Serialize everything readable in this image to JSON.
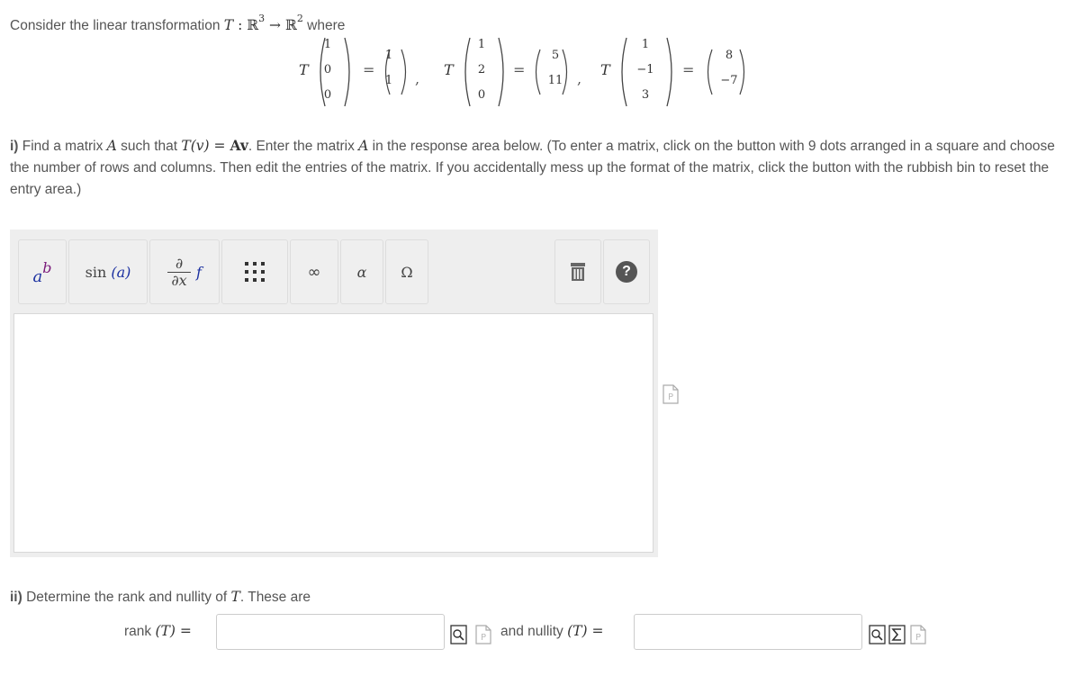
{
  "intro": {
    "prefix": "Consider the linear transformation ",
    "map_T": "T",
    "colon": " : ",
    "domain": "ℝ",
    "domain_exp": "3",
    "arrow": " → ",
    "codomain": "ℝ",
    "codomain_exp": "2",
    "suffix": " where"
  },
  "equations": [
    {
      "T": "T",
      "input": [
        "1",
        "0",
        "0"
      ],
      "output": [
        "1",
        "1"
      ]
    },
    {
      "T": "T",
      "input": [
        "1",
        "2",
        "0"
      ],
      "output": [
        "5",
        "11"
      ]
    },
    {
      "T": "T",
      "input": [
        "1",
        "−1",
        "3"
      ],
      "output": [
        "8",
        "−7"
      ]
    }
  ],
  "part_i": {
    "label": "i)",
    "t1": " Find a matrix ",
    "A1": "A",
    "t2": " such that ",
    "Tv": "T(v)",
    "eq": " = ",
    "Av": "Av",
    "t3": ". Enter the matrix ",
    "A2": "A",
    "t4": " in the response area below. (To enter a matrix, click on the button with 9 dots arranged in a square and choose the number of rows and columns.  Then edit the entries of the matrix.  If you accidentally mess up the format of the matrix, click the button with the rubbish bin to reset the entry area.)"
  },
  "toolbar": {
    "power": {
      "base": "a",
      "exp": "b"
    },
    "sin": {
      "fn": "sin",
      "arg": "(a)"
    },
    "deriv": {
      "num": "∂",
      "den": "∂x",
      "f": "f"
    },
    "infinity": "∞",
    "alpha": "α",
    "omega": "Ω",
    "help": "?"
  },
  "part_ii": {
    "label": "ii)",
    "t1": " Determine the rank and nullity of ",
    "T": "T",
    "t2": ". These are"
  },
  "rank": {
    "word": "rank ",
    "arg": "(T)",
    "eq": " ="
  },
  "nullity": {
    "prefix": "and ",
    "word": "nullity ",
    "arg": "(T)",
    "eq": " ="
  },
  "colors": {
    "accent_blue": "#1a2fa0",
    "accent_purple": "#7a1a7a",
    "toolbar_bg": "#eeeeee"
  }
}
